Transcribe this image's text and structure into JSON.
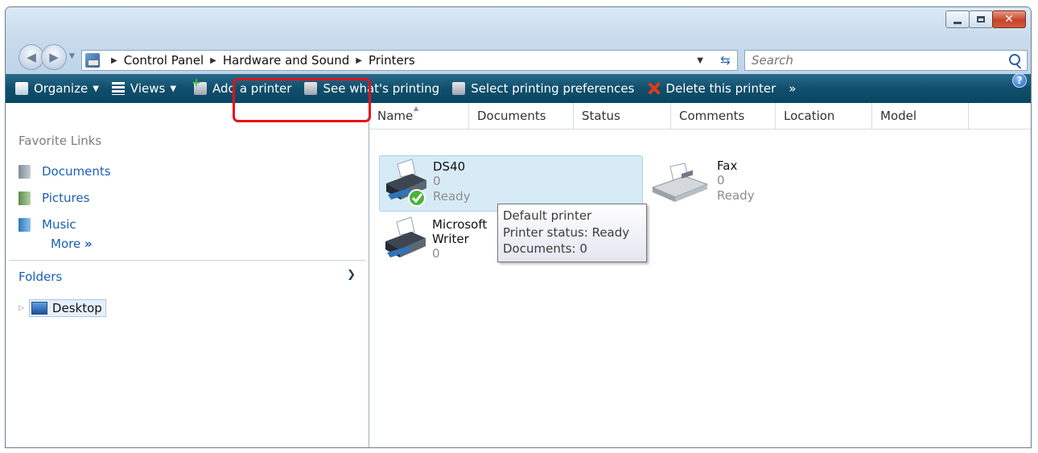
{
  "address": {
    "crumbs": [
      "Control Panel",
      "Hardware and Sound",
      "Printers"
    ]
  },
  "search": {
    "placeholder": "Search"
  },
  "toolbar": {
    "organize": "Organize",
    "views": "Views",
    "add_printer": "Add a printer",
    "see_printing": "See what's printing",
    "select_prefs": "Select printing preferences",
    "delete_printer": "Delete this printer",
    "overflow": "»",
    "help": "?"
  },
  "sidebar": {
    "favorites_title": "Favorite Links",
    "favorites": [
      {
        "label": "Documents",
        "icon": "documents-icon"
      },
      {
        "label": "Pictures",
        "icon": "pictures-icon"
      },
      {
        "label": "Music",
        "icon": "music-icon"
      }
    ],
    "more": "More",
    "more_arrow": "»",
    "folders_label": "Folders",
    "tree": [
      {
        "label": "Desktop",
        "icon": "desktop-icon"
      }
    ]
  },
  "columns": [
    "Name",
    "Documents",
    "Status",
    "Comments",
    "Location",
    "Model"
  ],
  "printers": [
    {
      "name": "DS40",
      "documents": "0",
      "status": "Ready",
      "icon": "printer-icon",
      "default": true
    },
    {
      "name": "Fax",
      "documents": "0",
      "status": "Ready",
      "icon": "fax-icon"
    },
    {
      "name_line1": "Microsoft",
      "name_line2": "Writer",
      "documents": "0",
      "icon": "printer-icon"
    }
  ],
  "tooltip": {
    "line1": "Default printer",
    "line2": "Printer status: Ready",
    "line3": "Documents: 0"
  },
  "colors": {
    "command_bar": "#0f4f6c",
    "link": "#1a5fb4",
    "highlight_box": "#e4101c",
    "selection": "#d7ebf7"
  }
}
